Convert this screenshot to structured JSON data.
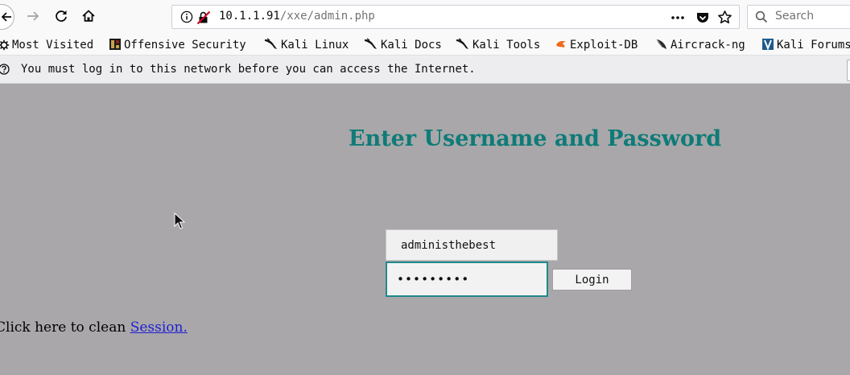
{
  "browser": {
    "url_host": "10.1.1.91",
    "url_path": "/xxe/admin.php",
    "search_placeholder": "Search",
    "page_actions_label": "•••"
  },
  "bookmarks": [
    {
      "label": "Most Visited",
      "icon": "gear-icon"
    },
    {
      "label": "Offensive Security",
      "icon": "offsec-icon"
    },
    {
      "label": "Kali Linux",
      "icon": "kali-dragon-icon"
    },
    {
      "label": "Kali Docs",
      "icon": "kali-dragon-icon"
    },
    {
      "label": "Kali Tools",
      "icon": "kali-dragon-icon"
    },
    {
      "label": "Exploit-DB",
      "icon": "exploitdb-icon"
    },
    {
      "label": "Aircrack-ng",
      "icon": "aircrack-icon"
    },
    {
      "label": "Kali Forums",
      "icon": "kali-forums-icon"
    }
  ],
  "notification": {
    "text": "You must log in to this network before you can access the Internet."
  },
  "page": {
    "heading": "Enter Username and Password",
    "username_value": "administhebest",
    "password_value": "•••••••••",
    "login_label": "Login",
    "session_prefix": "Click here to clean ",
    "session_link": "Session."
  },
  "colors": {
    "page_background": "#a9a7a9",
    "heading": "#0e7b78",
    "link": "#1f1fd2",
    "focus_border": "#21898c"
  }
}
